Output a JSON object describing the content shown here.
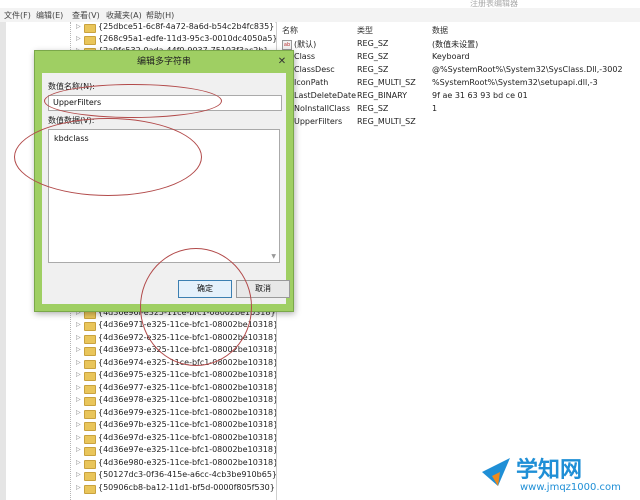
{
  "window": {
    "title": "注册表编辑器"
  },
  "menu": [
    "文件(F)",
    "编辑(E)",
    "查看(V)",
    "收藏夹(A)",
    "帮助(H)"
  ],
  "tree": {
    "top_items": [
      "{25dbce51-6c8f-4a72-8a6d-b54c2b4fc835}",
      "{268c95a1-edfe-11d3-95c3-0010dc4050a5}",
      "{2a9fc532-0ada-44f0-9037-75103f3ac2b}"
    ],
    "bottom_items": [
      "{4d36e96f-e325-11ce-bfc1-08002be10318}",
      "{4d36e971-e325-11ce-bfc1-08002be10318}",
      "{4d36e972-e325-11ce-bfc1-08002be10318}",
      "{4d36e973-e325-11ce-bfc1-08002be10318}",
      "{4d36e974-e325-11ce-bfc1-08002be10318}",
      "{4d36e975-e325-11ce-bfc1-08002be10318}",
      "{4d36e977-e325-11ce-bfc1-08002be10318}",
      "{4d36e978-e325-11ce-bfc1-08002be10318}",
      "{4d36e979-e325-11ce-bfc1-08002be10318}",
      "{4d36e97b-e325-11ce-bfc1-08002be10318}",
      "{4d36e97d-e325-11ce-bfc1-08002be10318}",
      "{4d36e97e-e325-11ce-bfc1-08002be10318}",
      "{4d36e980-e325-11ce-bfc1-08002be10318}",
      "{50127dc3-0f36-415e-a6cc-4cb3be910b65}",
      "{50906cb8-ba12-11d1-bf5d-0000f805f530}"
    ]
  },
  "values": {
    "headers": {
      "name": "名称",
      "type": "类型",
      "data": "数据"
    },
    "rows": [
      {
        "name": "(默认)",
        "type": "REG_SZ",
        "data": "(数值未设置)"
      },
      {
        "name": "Class",
        "type": "REG_SZ",
        "data": "Keyboard"
      },
      {
        "name": "ClassDesc",
        "type": "REG_SZ",
        "data": "@%SystemRoot%\\System32\\SysClass.Dll,-3002"
      },
      {
        "name": "IconPath",
        "type": "REG_MULTI_SZ",
        "data": "%SystemRoot%\\System32\\setupapi.dll,-3"
      },
      {
        "name": "LastDeleteDate",
        "type": "REG_BINARY",
        "data": "9f ae 31 63 93 bd ce 01"
      },
      {
        "name": "NoInstallClass",
        "type": "REG_SZ",
        "data": "1"
      },
      {
        "name": "UpperFilters",
        "type": "REG_MULTI_SZ",
        "data": ""
      }
    ]
  },
  "dialog": {
    "title": "编辑多字符串",
    "close_glyph": "✕",
    "name_label": "数值名称(N):",
    "name_value": "UpperFilters",
    "data_label": "数值数据(V):",
    "data_value": "kbdclass",
    "ok_label": "确定",
    "cancel_label": "取消",
    "accent_color": "#9fcf63"
  },
  "annotations": {
    "circle_color": "#b24a4a"
  },
  "watermark": {
    "text": "学知网",
    "url": "www.jmqz1000.com",
    "color": "#1f8fd6"
  }
}
